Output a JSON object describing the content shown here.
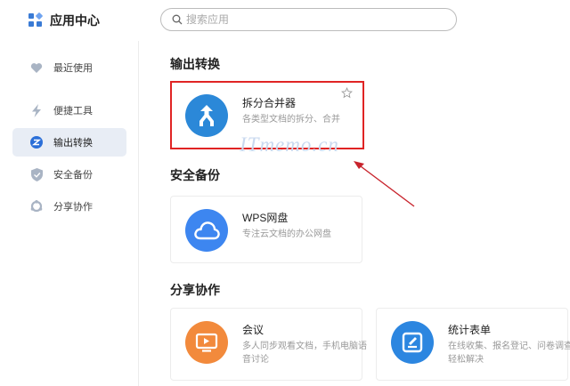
{
  "header": {
    "title": "应用中心",
    "search_placeholder": "搜索应用"
  },
  "sidebar": {
    "items": [
      {
        "label": "最近使用",
        "icon": "heart-icon"
      },
      {
        "label": "便捷工具",
        "icon": "lightning-icon"
      },
      {
        "label": "输出转换",
        "icon": "convert-icon",
        "active": true
      },
      {
        "label": "安全备份",
        "icon": "shield-icon"
      },
      {
        "label": "分享协作",
        "icon": "share-circle-icon"
      }
    ]
  },
  "sections": [
    {
      "title": "输出转换",
      "apps": [
        {
          "name": "拆分合并器",
          "desc": "各类型文档的拆分、合并",
          "icon": "split-merge-icon",
          "color": "#2b88d8"
        }
      ]
    },
    {
      "title": "安全备份",
      "apps": [
        {
          "name": "WPS网盘",
          "desc": "专注云文档的办公网盘",
          "icon": "cloud-icon",
          "color": "#3d86f0"
        }
      ]
    },
    {
      "title": "分享协作",
      "apps": [
        {
          "name": "会议",
          "desc": "多人同步观看文档，手机电脑语音讨论",
          "icon": "meeting-icon",
          "color": "#f28a3c"
        },
        {
          "name": "统计表单",
          "desc": "在线收集、报名登记、问卷调查轻松解决",
          "icon": "form-icon",
          "color": "#2c86e0"
        }
      ]
    }
  ],
  "watermark": "ITmemo.cn",
  "colors": {
    "highlight": "#e02424",
    "active_bg": "#e8edf5"
  }
}
